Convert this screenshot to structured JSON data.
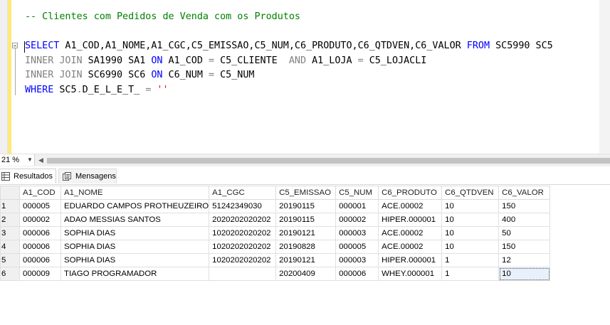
{
  "editor": {
    "lines": {
      "comment": "-- Clientes com Pedidos de Venda com os Produtos",
      "select_kw": "SELECT",
      "select_cols": " A1_COD,A1_NOME,A1_CGC,C5_EMISSAO,C5_NUM,C6_PRODUTO,C6_QTDVEN,C6_VALOR ",
      "from_kw": "FROM",
      "from_table": " SC5990 SC5",
      "join1_kw": "INNER JOIN",
      "join1_table": " SA1990 SA1 ",
      "join1_on": "ON",
      "join1_cond_a": " A1_COD ",
      "join1_eq_a": "=",
      "join1_cond_b": " C5_CLIENTE  ",
      "join1_and": "AND",
      "join1_cond_c": " A1_LOJA ",
      "join1_eq_b": "=",
      "join1_cond_d": " C5_LOJACLI",
      "join2_kw": "INNER JOIN",
      "join2_table": " SC6990 SC6 ",
      "join2_on": "ON",
      "join2_cond_a": " C6_NUM ",
      "join2_eq": "=",
      "join2_cond_b": " C5_NUM",
      "where_kw": "WHERE",
      "where_field": " SC5",
      "where_dot": ".",
      "where_field2": "D_E_L_E_T_ ",
      "where_eq": "=",
      "where_value": " ''"
    }
  },
  "statusbar": {
    "zoom": "21 %"
  },
  "tabs": {
    "results": "Resultados",
    "messages": "Mensagens"
  },
  "grid": {
    "columns": [
      "A1_COD",
      "A1_NOME",
      "A1_CGC",
      "C5_EMISSAO",
      "C5_NUM",
      "C6_PRODUTO",
      "C6_QTDVEN",
      "C6_VALOR"
    ],
    "rows": [
      {
        "n": "1",
        "cells": [
          "000005",
          "EDUARDO CAMPOS PROTHEUZEIRO",
          " 51242349030",
          "20190115",
          "000001",
          "ACE.00002",
          "10",
          "150"
        ]
      },
      {
        "n": "2",
        "cells": [
          "000002",
          "ADAO MESSIAS SANTOS",
          "2020202020202",
          "20190115",
          "000002",
          "HIPER.000001",
          "10",
          "400"
        ]
      },
      {
        "n": "3",
        "cells": [
          "000006",
          "SOPHIA DIAS",
          "1020202020202",
          "20190121",
          "000003",
          "ACE.00002",
          "10",
          "50"
        ]
      },
      {
        "n": "4",
        "cells": [
          "000006",
          "SOPHIA DIAS",
          "1020202020202",
          "20190828",
          "000005",
          "ACE.00002",
          "10",
          "150"
        ]
      },
      {
        "n": "5",
        "cells": [
          "000006",
          "SOPHIA DIAS",
          "1020202020202",
          "20190121",
          "000003",
          "HIPER.000001",
          "1",
          "12"
        ]
      },
      {
        "n": "6",
        "cells": [
          "000009",
          "TIAGO PROGRAMADOR",
          "",
          "20200409",
          "000006",
          "WHEY.000001",
          "1",
          "10"
        ]
      }
    ]
  }
}
